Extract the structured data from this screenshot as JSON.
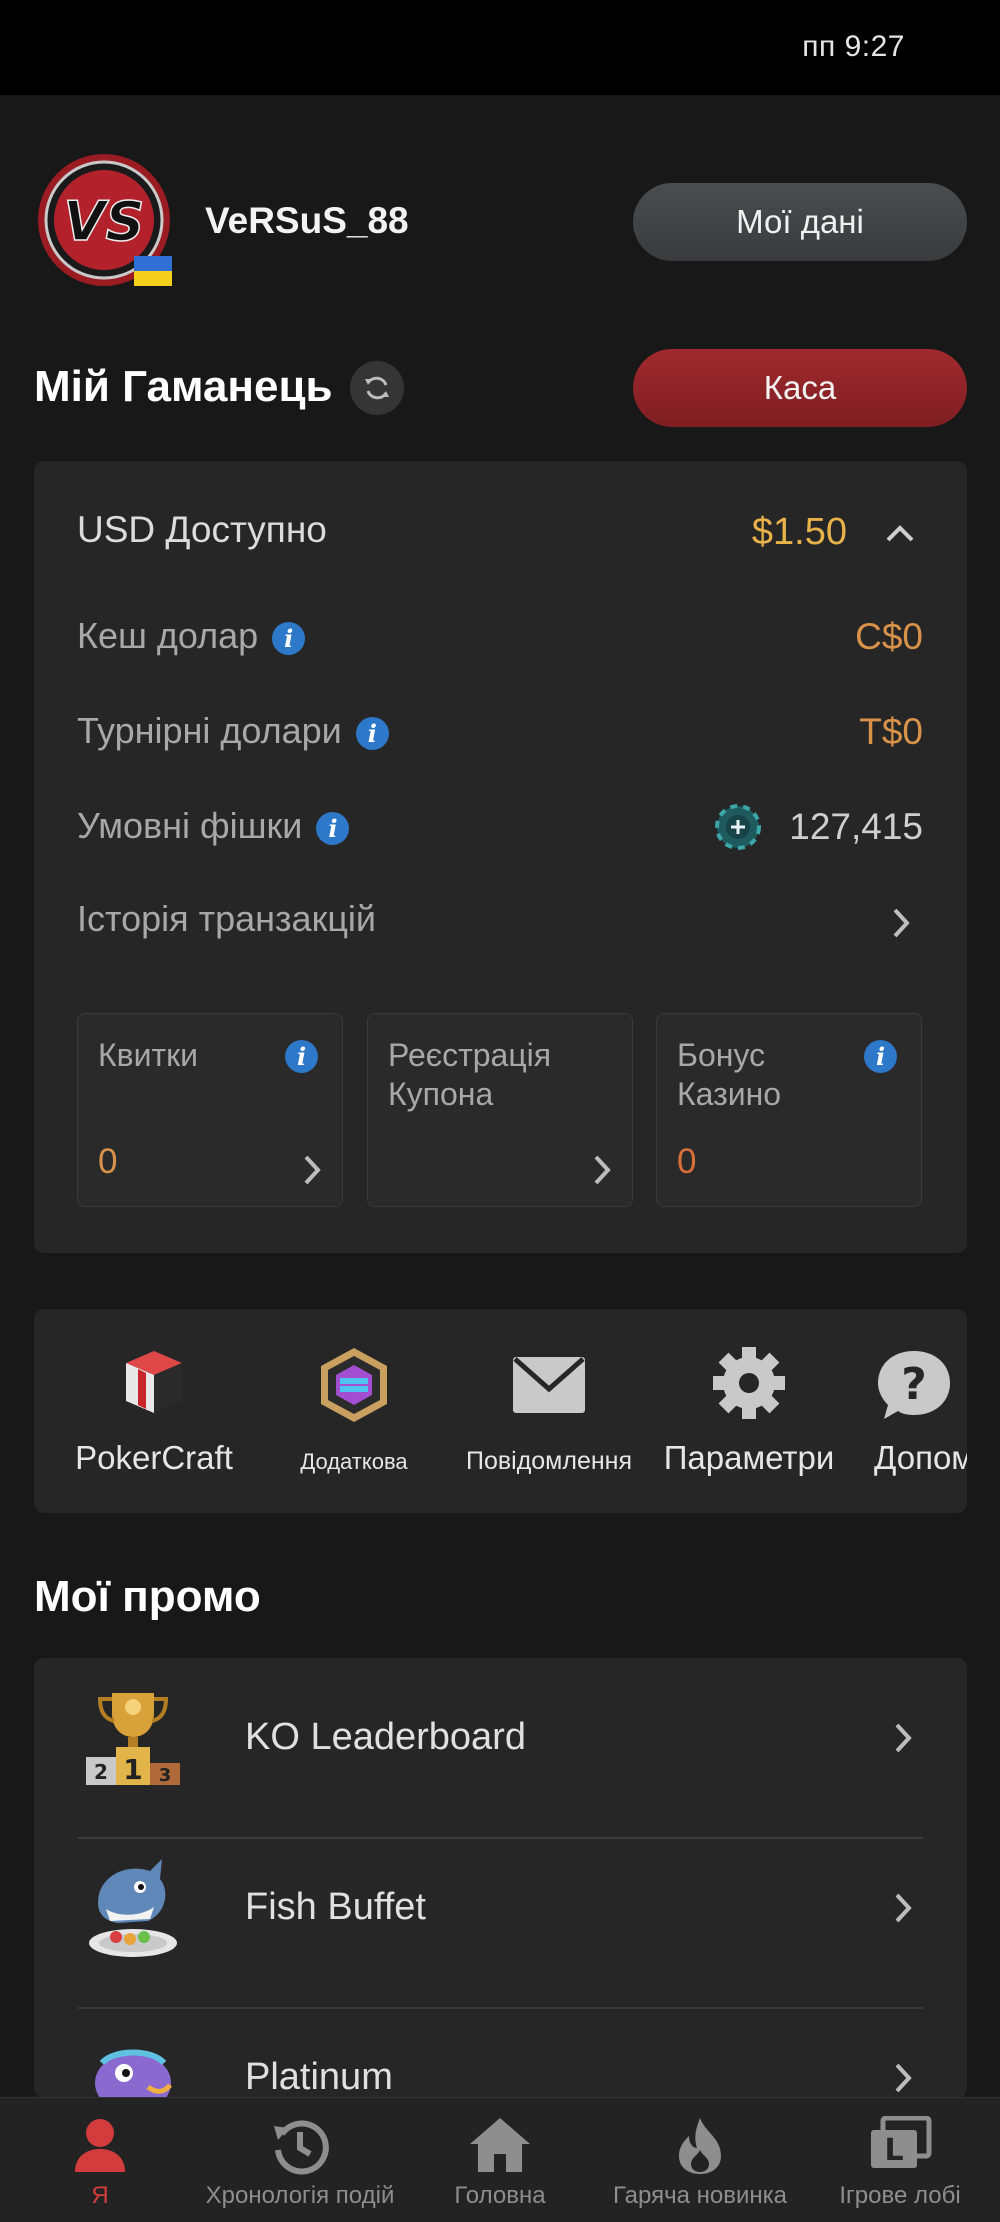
{
  "status_bar": {
    "time": "пп 9:27"
  },
  "profile": {
    "username": "VeRSuS_88",
    "my_data_button": "Мої дані"
  },
  "wallet": {
    "title": "Мій Гаманець",
    "cashier_button": "Каса",
    "usd_available_label": "USD Доступно",
    "usd_available_value": "$1.50",
    "cash_dollars_label": "Кеш долар",
    "cash_dollars_value": "C$0",
    "tournament_dollars_label": "Турнірні долари",
    "tournament_dollars_value": "T$0",
    "play_chips_label": "Умовні фішки",
    "play_chips_value": "127,415",
    "history_label": "Історія транзакцій",
    "tiles": [
      {
        "label": "Квитки",
        "value": "0"
      },
      {
        "label": "Реєстрація Купона",
        "value": ""
      },
      {
        "label": "Бонус Казино",
        "value": "0"
      }
    ]
  },
  "tools": [
    {
      "label": "PokerCraft",
      "icon": "pokercraft-icon"
    },
    {
      "label": "Додаткова",
      "icon": "extras-icon"
    },
    {
      "label": "Повідомлення",
      "icon": "mail-icon"
    },
    {
      "label": "Параметри",
      "icon": "gear-icon"
    },
    {
      "label": "Допом",
      "icon": "help-icon"
    }
  ],
  "promos": {
    "title": "Мої промо",
    "items": [
      {
        "name": "KO Leaderboard",
        "icon": "trophy-icon"
      },
      {
        "name": "Fish Buffet",
        "icon": "shark-icon"
      },
      {
        "name": "Platinum",
        "icon": "fish-icon"
      }
    ]
  },
  "nav": [
    {
      "label": "Я",
      "icon": "person-icon",
      "active": true
    },
    {
      "label": "Хронологія подій",
      "icon": "history-icon"
    },
    {
      "label": "Головна",
      "icon": "home-icon"
    },
    {
      "label": "Гаряча новинка",
      "icon": "flame-icon"
    },
    {
      "label": "Ігрове лобі",
      "icon": "lobby-icon"
    }
  ],
  "colors": {
    "accent_red": "#9c2529",
    "gold": "#e8b24a",
    "orange": "#d9924a",
    "info_blue": "#2d78c8"
  }
}
